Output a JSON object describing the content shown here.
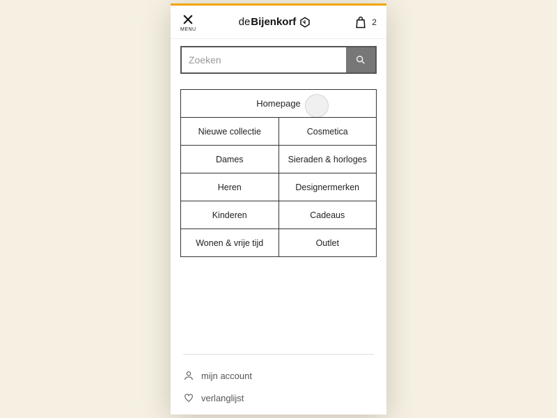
{
  "header": {
    "menu_label": "MENU",
    "logo_prefix": "de",
    "logo_main": "Bijenkorf",
    "bag_count": "2"
  },
  "search": {
    "placeholder": "Zoeken"
  },
  "categories": {
    "homepage": "Homepage",
    "rows": [
      {
        "left": "Nieuwe collectie",
        "right": "Cosmetica"
      },
      {
        "left": "Dames",
        "right": "Sieraden & horloges"
      },
      {
        "left": "Heren",
        "right": "Designermerken"
      },
      {
        "left": "Kinderen",
        "right": "Cadeaus"
      },
      {
        "left": "Wonen & vrije tijd",
        "right": "Outlet"
      }
    ]
  },
  "footer": {
    "account": "mijn account",
    "wishlist": "verlanglijst"
  }
}
